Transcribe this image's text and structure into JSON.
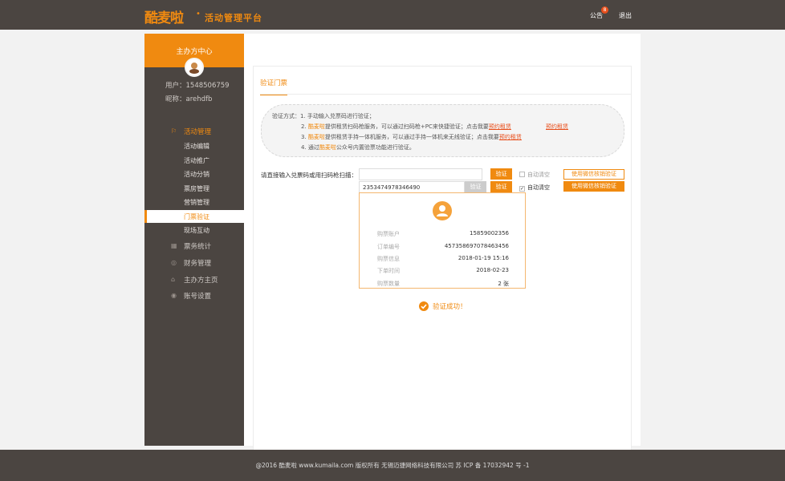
{
  "header": {
    "logo_text": "酷麦啦",
    "platform_title": "活动管理平台",
    "notice_label": "公告",
    "notice_count": "8",
    "logout_label": "退出"
  },
  "sidebar": {
    "center_title": "主办方中心",
    "user_id_line": "用户：1548506759",
    "nickname_line": "昵称：arehdfb",
    "groups": [
      {
        "label": "活动管理",
        "icon": "flag-icon"
      },
      {
        "label": "票务统计",
        "icon": "stats-icon"
      },
      {
        "label": "财务管理",
        "icon": "finance-icon"
      },
      {
        "label": "主办方主页",
        "icon": "home-icon"
      },
      {
        "label": "账号设置",
        "icon": "settings-icon"
      }
    ],
    "subitems": [
      "活动编辑",
      "活动推广",
      "活动分销",
      "票房管理",
      "营销管理",
      "门票验证",
      "现场互动"
    ],
    "current_subitem": "门票验证",
    "accent_color": "#f08a10"
  },
  "main": {
    "tab_label": "验证门票",
    "instructions": {
      "prefix": "验证方式：",
      "line1": "1. 手动输入兑票码进行验证；",
      "line2_num": "2. ",
      "brand": "酷麦啦",
      "line2_text": "提供租赁扫码枪服务，可以通过扫码枪+PC来快捷验证；点击我要",
      "rent_link": "预约租赁",
      "extra_link": "预约租赁",
      "line3_num": "3. ",
      "line3_text": "提供租赁手持一体机服务，可以通过手持一体机来无线验证；点击我要",
      "line4_num": "4. 通过",
      "line4_text": "公众号内置验票功能进行验证。"
    },
    "verify": {
      "label": "请直接输入兑票码或用扫码枪扫描：",
      "input_placeholder": "",
      "input_value": "2353474978346490",
      "verify_btn": "验证",
      "verify_gray_btn": "验证",
      "auto_clear": "自动清空",
      "wx_btn_outline": "使用微信核销验证",
      "wx_btn_solid": "使用微信核销验证"
    },
    "result": {
      "rows": [
        {
          "key": "购票账户",
          "value": "15859002356"
        },
        {
          "key": "订单编号",
          "value": "457358697078463456"
        },
        {
          "key": "购票信息",
          "value": "2018-01-19  15:16"
        },
        {
          "key": "下单时间",
          "value": "2018-02-23"
        },
        {
          "key": "购票数量",
          "value": "2 张"
        }
      ]
    },
    "success_text": "验证成功！"
  },
  "footer": {
    "text": "@2016 酷麦啦 www.kumaila.com 版权所有 无锡迈捷网络科技有限公司 苏 ICP 备 17032942 号 -1"
  }
}
